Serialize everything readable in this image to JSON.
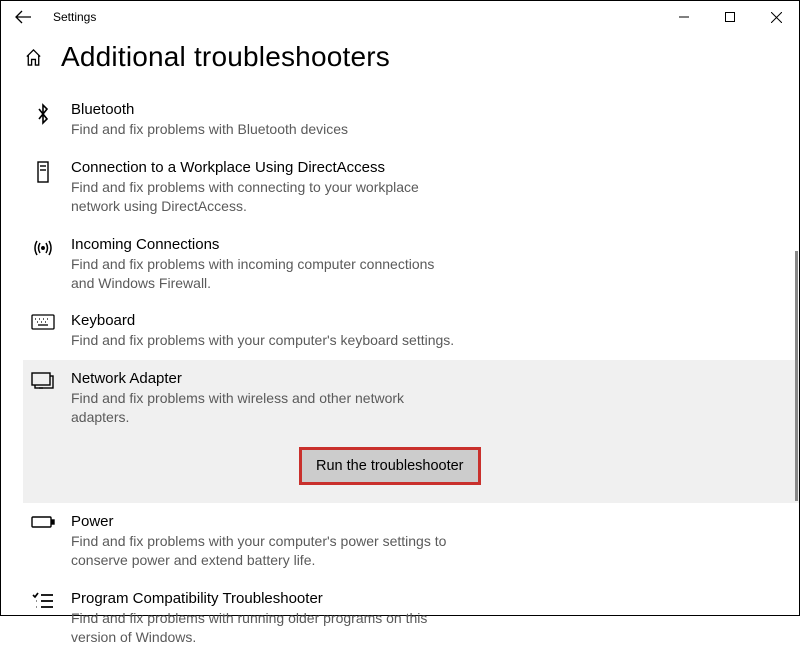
{
  "titlebar": {
    "title": "Settings"
  },
  "page": {
    "title": "Additional troubleshooters"
  },
  "items": [
    {
      "title": "Bluetooth",
      "desc": "Find and fix problems with Bluetooth devices"
    },
    {
      "title": "Connection to a Workplace Using DirectAccess",
      "desc": "Find and fix problems with connecting to your workplace network using DirectAccess."
    },
    {
      "title": "Incoming Connections",
      "desc": "Find and fix problems with incoming computer connections and Windows Firewall."
    },
    {
      "title": "Keyboard",
      "desc": "Find and fix problems with your computer's keyboard settings."
    },
    {
      "title": "Network Adapter",
      "desc": "Find and fix problems with wireless and other network adapters."
    },
    {
      "title": "Power",
      "desc": "Find and fix problems with your computer's power settings to conserve power and extend battery life."
    },
    {
      "title": "Program Compatibility Troubleshooter",
      "desc": "Find and fix problems with running older programs on this version of Windows."
    }
  ],
  "buttons": {
    "run": "Run the troubleshooter"
  }
}
